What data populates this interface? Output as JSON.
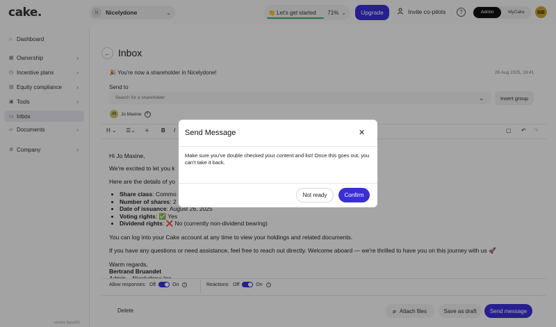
{
  "brand": {
    "logo_text": "cake."
  },
  "header": {
    "company_badge": "N",
    "company_name": "Nicelydone",
    "get_started_label": "👏 Let's get started",
    "progress_percent": 71,
    "progress_text": "71%",
    "upgrade_label": "Upgrade",
    "invite_label": "Invite co-pilots",
    "role_admin": "Admin",
    "role_mycake": "MyCake",
    "avatar_initials": "BB"
  },
  "sidebar": {
    "items": [
      {
        "label": "Dashboard"
      },
      {
        "label": "Ownership"
      },
      {
        "label": "Incentive plans"
      },
      {
        "label": "Equity compliance"
      },
      {
        "label": "Tools"
      },
      {
        "label": "Inbox"
      },
      {
        "label": "Documents"
      },
      {
        "label": "Company"
      }
    ],
    "version": "version 9aea426"
  },
  "inbox": {
    "title": "Inbox",
    "subject": "🎉 You're now a shareholder in Nicelydone!",
    "date": "26 Aug 2025, 19:41",
    "send_to_label": "Send to",
    "search_placeholder": "Search for a shareholder",
    "insert_group_label": "Insert group",
    "recipient_initials": "JM",
    "recipient_name": "Jo Maxine"
  },
  "toolbar": {
    "heading": "H"
  },
  "email": {
    "greeting": "Hi Jo Maxine,",
    "intro": "We're excited to let you k",
    "details_intro": "Here are the details of yo",
    "share_class_label": "Share class",
    "share_class_value": ": Commo",
    "num_shares_label": "Number of shares",
    "num_shares_value": ": 2",
    "issue_date_label": "Date of issuance",
    "issue_date_value": ": August 26, 2025",
    "voting_label": "Voting rights",
    "voting_value": ": ✅ Yes",
    "dividend_label": "Dividend rights",
    "dividend_value": ": ❌ No (currently non-dividend bearing)",
    "login_line": "You can log into your Cake account at any time to view your holdings and related documents.",
    "questions_line": "If you have any questions or need assistance, feel free to reach out directly. Welcome aboard — we're thrilled to have you on this journey with us 🚀",
    "regards": "Warm regards,",
    "signer": "Bertrand Bruandet",
    "signer_title": "Admin – Nicelydone Inc."
  },
  "options": {
    "allow_responses_label": "Allow responses:",
    "reactions_label": "Reactions:",
    "off_label": "Off",
    "on_label": "On"
  },
  "footer": {
    "delete_label": "Delete",
    "attach_label": "Attach files",
    "draft_label": "Save as draft",
    "send_label": "Send message"
  },
  "modal": {
    "title": "Send Message",
    "body": "Make sure you've double checked your content and list! Once this goes out, you can't take it back.",
    "not_ready_label": "Not ready",
    "confirm_label": "Confirm"
  },
  "colors": {
    "accent": "#3a2fd6",
    "progress": "#2db36b"
  }
}
